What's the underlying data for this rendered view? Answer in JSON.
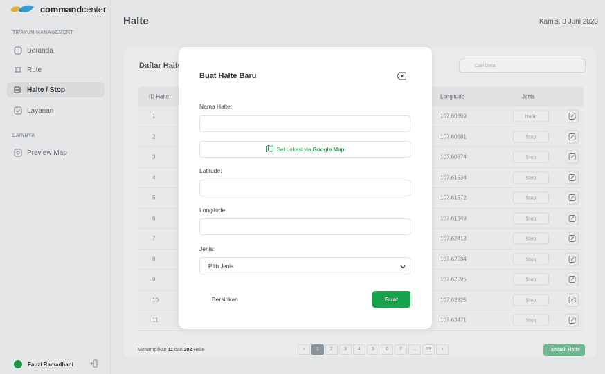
{
  "app": {
    "logo_bold": "command",
    "logo_light": "center"
  },
  "sidebar": {
    "section_main": "TIPAYUN MANAGEMENT",
    "section_other": "LAINNYA",
    "items": [
      {
        "label": "Beranda",
        "icon": "home-icon"
      },
      {
        "label": "Rute",
        "icon": "route-icon"
      },
      {
        "label": "Halte / Stop",
        "icon": "bus-stop-icon",
        "active": true
      },
      {
        "label": "Layanan",
        "icon": "service-icon"
      }
    ],
    "other_items": [
      {
        "label": "Preview Map",
        "icon": "eye-icon"
      }
    ],
    "user": {
      "name": "Fauzi Ramadhani"
    }
  },
  "header": {
    "title": "Halte",
    "date": "Kamis, 8 Juni 2023"
  },
  "list": {
    "title": "Daftar Halte",
    "search_placeholder": "Cari Data",
    "columns": {
      "id": "ID Halte",
      "longitude": "Longitude",
      "jenis": "Jenis"
    },
    "rows": [
      {
        "id": "1",
        "longitude": "107.60669",
        "jenis": "Halte"
      },
      {
        "id": "2",
        "longitude": "107.60681",
        "jenis": "Stop"
      },
      {
        "id": "3",
        "longitude": "107.60874",
        "jenis": "Stop"
      },
      {
        "id": "4",
        "longitude": "107.61534",
        "jenis": "Stop"
      },
      {
        "id": "5",
        "longitude": "107.61572",
        "jenis": "Stop"
      },
      {
        "id": "6",
        "longitude": "107.61649",
        "jenis": "Stop"
      },
      {
        "id": "7",
        "longitude": "107.62413",
        "jenis": "Stop"
      },
      {
        "id": "8",
        "longitude": "107.62534",
        "jenis": "Stop"
      },
      {
        "id": "9",
        "longitude": "107.62595",
        "jenis": "Stop"
      },
      {
        "id": "10",
        "longitude": "107.62825",
        "jenis": "Stop"
      },
      {
        "id": "11",
        "longitude": "107.63471",
        "jenis": "Stop"
      }
    ],
    "footer": {
      "prefix": "Menampilkan",
      "shown": "11",
      "middle": "dari",
      "total": "202",
      "suffix": "Halte"
    },
    "pagination": {
      "prev": "‹",
      "pages": [
        "1",
        "2",
        "3",
        "4",
        "5",
        "6",
        "7",
        "...",
        "19"
      ],
      "next": "›",
      "current": "1"
    },
    "add_label": "Tambah Halte"
  },
  "modal": {
    "title": "Buat Halte Baru",
    "name_label": "Nama Halte:",
    "map_button_prefix": "Set Lokasi via",
    "map_button_bold": "Google Map",
    "lat_label": "Latitude:",
    "lng_label": "Longitude:",
    "type_label": "Jenis:",
    "type_selected": "Pilih Jenis",
    "clear_label": "Bersihkan",
    "submit_label": "Buat"
  },
  "colors": {
    "accent": "#17a24b",
    "add_button": "#76c69a"
  }
}
